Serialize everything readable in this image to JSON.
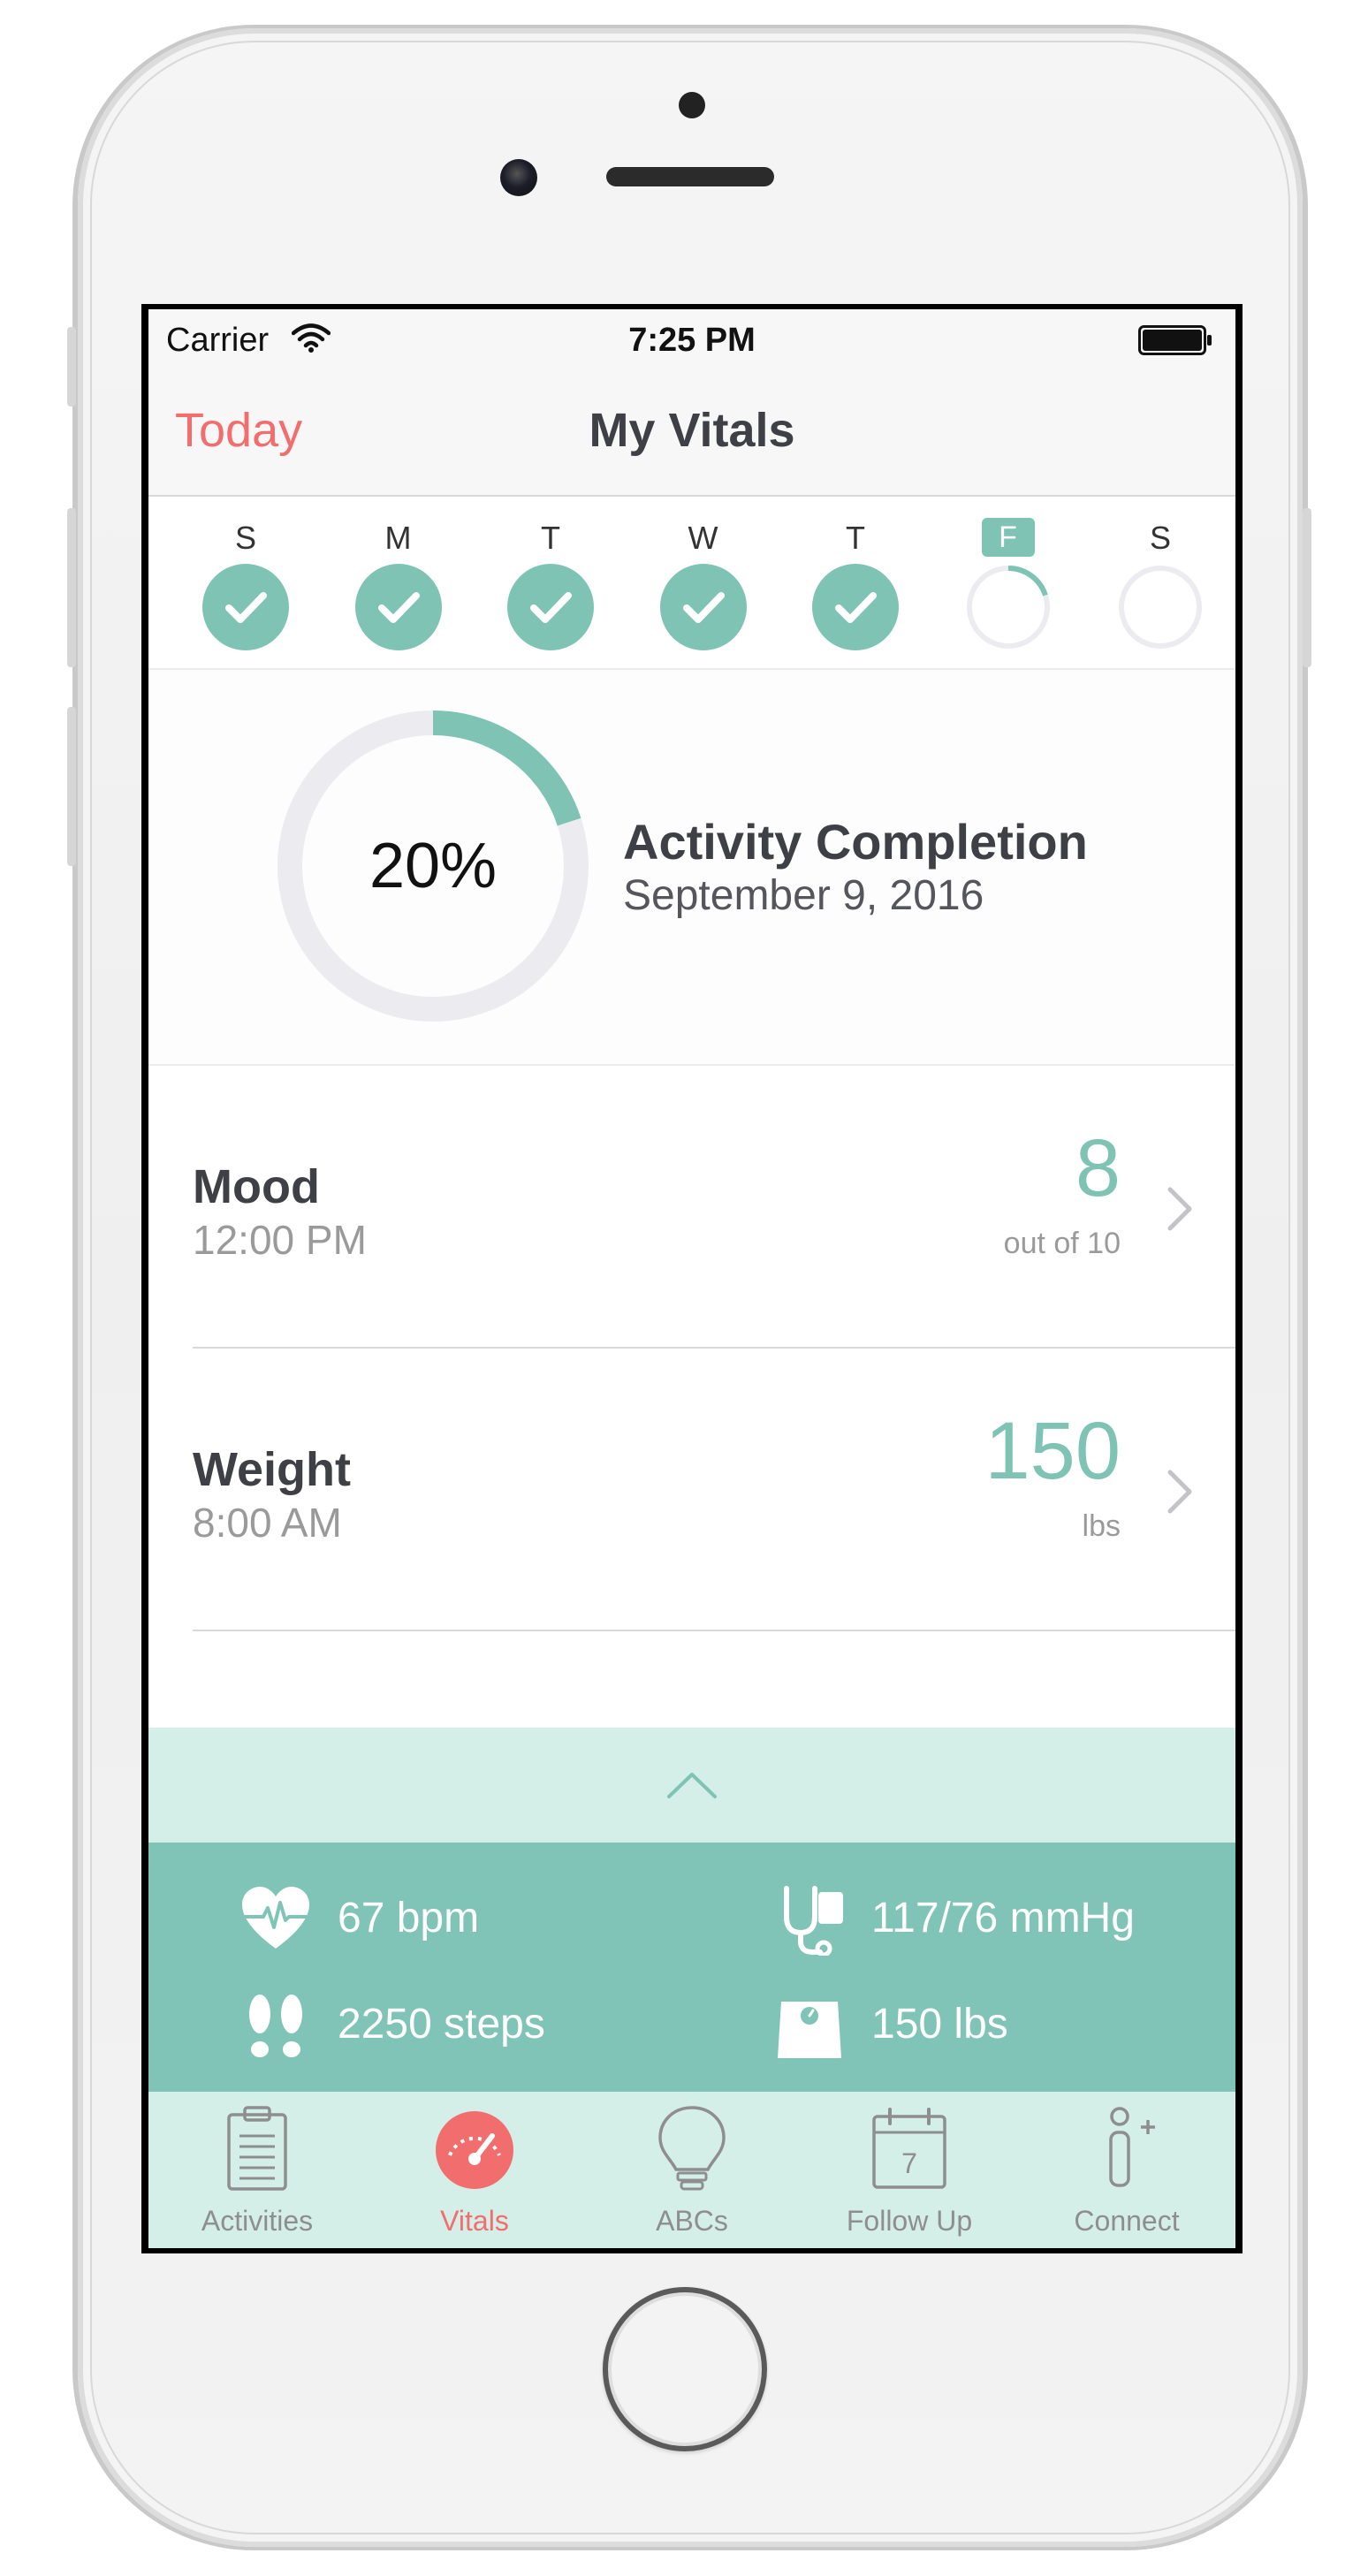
{
  "status_bar": {
    "carrier": "Carrier",
    "time": "7:25 PM"
  },
  "nav": {
    "back_label": "Today",
    "title": "My Vitals"
  },
  "week": {
    "days": [
      {
        "letter": "S",
        "state": "complete",
        "progress": 1.0
      },
      {
        "letter": "M",
        "state": "complete",
        "progress": 1.0
      },
      {
        "letter": "T",
        "state": "complete",
        "progress": 1.0
      },
      {
        "letter": "W",
        "state": "complete",
        "progress": 1.0
      },
      {
        "letter": "T",
        "state": "complete",
        "progress": 1.0
      },
      {
        "letter": "F",
        "state": "today",
        "progress": 0.2
      },
      {
        "letter": "S",
        "state": "future",
        "progress": 0.0
      }
    ]
  },
  "completion": {
    "percent_label": "20%",
    "progress": 0.2,
    "title": "Activity Completion",
    "date": "September 9, 2016"
  },
  "vitals": [
    {
      "name": "Mood",
      "time": "12:00 PM",
      "value": "8",
      "unit": "out of 10"
    },
    {
      "name": "Weight",
      "time": "8:00 AM",
      "value": "150",
      "unit": "lbs"
    }
  ],
  "summary": {
    "heart_rate": "67 bpm",
    "blood_pressure": "117/76 mmHg",
    "steps": "2250 steps",
    "weight": "150 lbs"
  },
  "tabs": [
    {
      "label": "Activities",
      "icon": "clipboard-icon",
      "active": false
    },
    {
      "label": "Vitals",
      "icon": "speedometer-icon",
      "active": true
    },
    {
      "label": "ABCs",
      "icon": "lightbulb-icon",
      "active": false
    },
    {
      "label": "Follow Up",
      "icon": "calendar-icon",
      "active": false,
      "calendar_day": "7"
    },
    {
      "label": "Connect",
      "icon": "add-person-icon",
      "active": false
    }
  ],
  "colors": {
    "accent_teal": "#7fc3b5",
    "accent_red": "#f26d6d",
    "panel_light": "#d4eee8",
    "panel_dark": "#80c4b7",
    "ring_track": "#ececf0"
  }
}
